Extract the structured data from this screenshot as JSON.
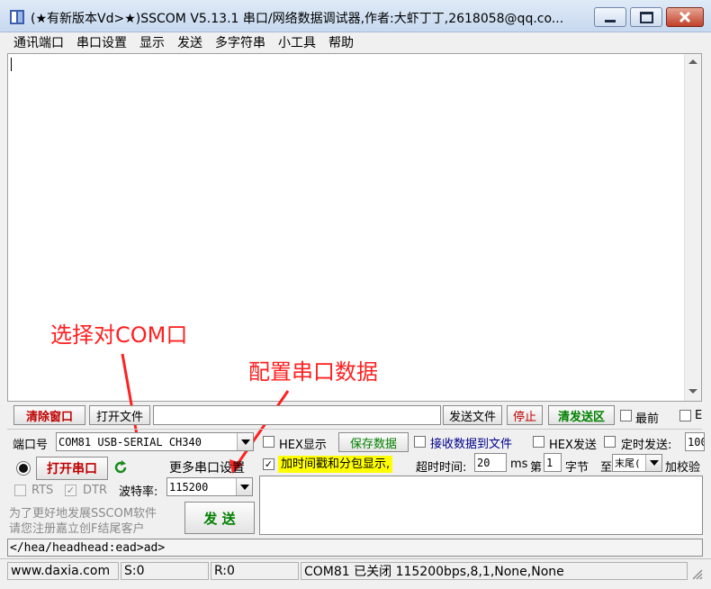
{
  "window": {
    "title": "(★有新版本Vd>★)SSCOM V5.13.1 串口/网络数据调试器,作者:大虾丁丁,2618058@qq.co..."
  },
  "menu": [
    "通讯端口",
    "串口设置",
    "显示",
    "发送",
    "多字符串",
    "小工具",
    "帮助"
  ],
  "toolbar": {
    "clear_window": "清除窗口",
    "open_file": "打开文件",
    "file_path": "",
    "send_file": "发送文件",
    "stop": "停止",
    "clear_send": "清发送区",
    "topmost": "最前",
    "en_label": "E"
  },
  "port": {
    "port_label": "端口号",
    "port_value": "COM81 USB-SERIAL CH340",
    "open_port": "打开串口",
    "more_settings": "更多串口设置",
    "rts": "RTS",
    "dtr": "DTR",
    "baud_label": "波特率:",
    "baud_value": "115200"
  },
  "options": {
    "hex_display": "HEX显示",
    "save_data": "保存数据",
    "recv_to_file": "接收数据到文件",
    "hex_send": "HEX发送",
    "timed_send": "定时发送:",
    "timed_value": "100",
    "timestamp": "加时间戳和分包显示,",
    "timeout_label": "超时时间:",
    "timeout_value": "20",
    "ms": "ms",
    "nth": "第",
    "byte_value": "1",
    "byte_label": "字节",
    "to": "至",
    "end_value": "末尾(",
    "checksum": "加校验"
  },
  "promo": {
    "line1": "为了更好地发展SSCOM软件",
    "line2": "请您注册嘉立创F结尾客户",
    "send": "发 送"
  },
  "send_text": "",
  "command_line": "</hea/headhead:ead>ad>",
  "status": {
    "site": "www.daxia.com",
    "s": "S:0",
    "r": "R:0",
    "info": "COM81 已关闭  115200bps,8,1,None,None"
  },
  "annotations": {
    "select_com": "选择对COM口",
    "config_serial": "配置串口数据"
  },
  "colors": {
    "annotation": "#ff2020",
    "button_text": "#c00000",
    "highlight": "#ffff00",
    "green_text": "#008000"
  }
}
